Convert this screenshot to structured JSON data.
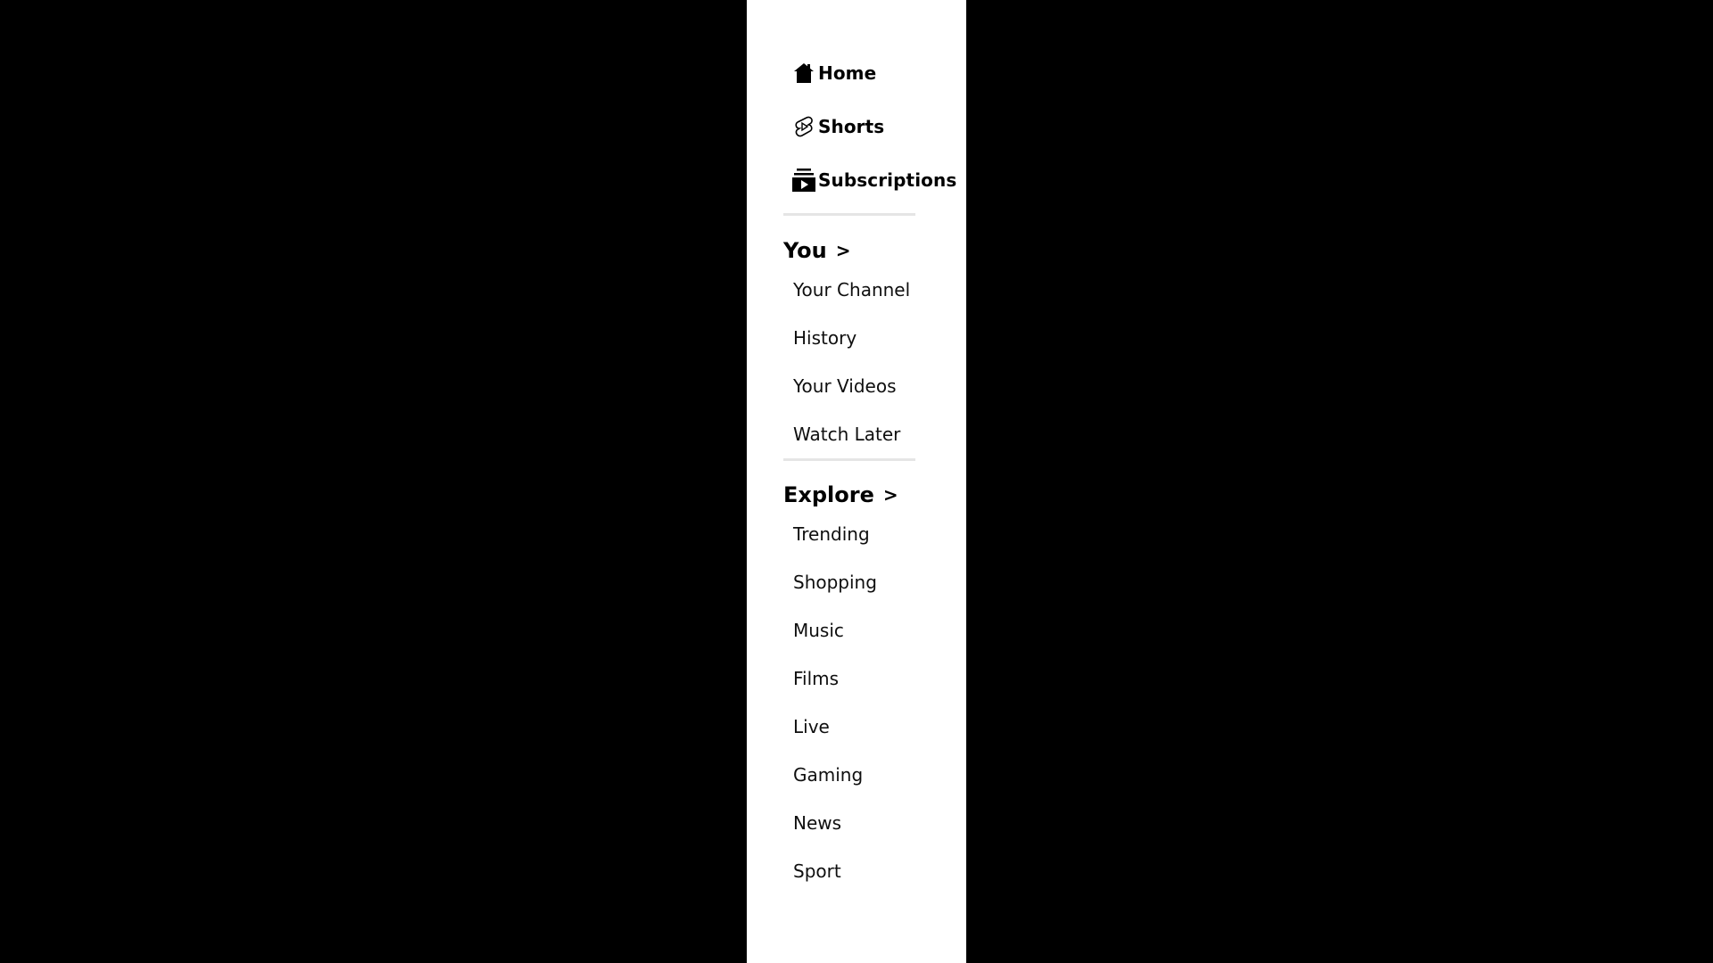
{
  "sidebar": {
    "primary": [
      {
        "label": "Home",
        "icon": "home-icon"
      },
      {
        "label": "Shorts",
        "icon": "shorts-icon"
      },
      {
        "label": "Subscriptions",
        "icon": "subscriptions-icon"
      }
    ],
    "you": {
      "title": "You",
      "chevron": ">",
      "items": [
        {
          "label": "Your Channel"
        },
        {
          "label": "History"
        },
        {
          "label": "Your Videos"
        },
        {
          "label": "Watch Later"
        }
      ]
    },
    "explore": {
      "title": "Explore",
      "chevron": ">",
      "items": [
        {
          "label": "Trending"
        },
        {
          "label": "Shopping"
        },
        {
          "label": "Music"
        },
        {
          "label": "Films"
        },
        {
          "label": "Live"
        },
        {
          "label": "Gaming"
        },
        {
          "label": "News"
        },
        {
          "label": "Sport"
        }
      ]
    }
  },
  "colors": {
    "background": "#000000",
    "sidebar": "#ffffff",
    "divider": "#e5e5e5",
    "text": "#000000"
  }
}
